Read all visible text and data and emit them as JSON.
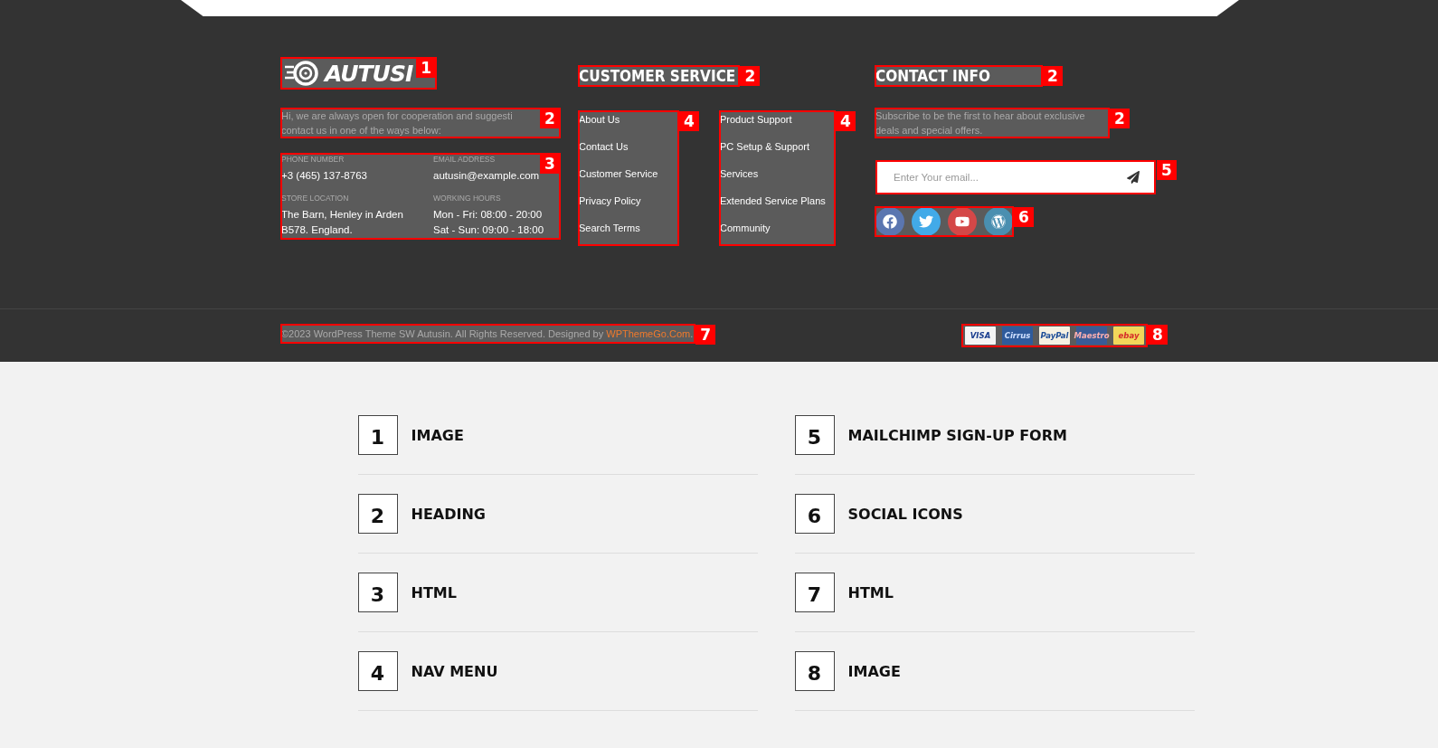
{
  "footer": {
    "brand": {
      "logo_text": "AUTUSI",
      "annotation": "1"
    },
    "intro": {
      "lines": [
        "Hi, we are always open for cooperation and suggesti",
        "contact us in one of the ways below:"
      ],
      "annotation": "2"
    },
    "contacts": {
      "annotation": "3",
      "items": [
        {
          "label": "PHONE NUMBER",
          "lines": [
            "+3 (465) 137-8763"
          ]
        },
        {
          "label": "EMAIL ADDRESS",
          "lines": [
            "autusin@example.com"
          ]
        },
        {
          "label": "STORE LOCATION",
          "lines": [
            "The Barn, Henley in Arden",
            "B578. England."
          ]
        },
        {
          "label": "WORKING HOURS",
          "lines": [
            "Mon - Fri: 08:00 - 20:00",
            "Sat - Sun: 09:00 - 18:00"
          ]
        }
      ]
    },
    "customer_service": {
      "heading": "CUSTOMER SERVICE",
      "heading_annotation": "2",
      "menus": [
        {
          "annotation": "4",
          "links": [
            "About Us",
            "Contact Us",
            "Customer Service",
            "Privacy Policy",
            "Search Terms"
          ]
        },
        {
          "annotation": "4",
          "links": [
            "Product Support",
            "PC Setup & Support",
            "Services",
            "Extended Service Plans",
            "Community"
          ]
        }
      ]
    },
    "contact_info": {
      "heading": "CONTACT INFO",
      "heading_annotation": "2",
      "text": {
        "lines": [
          "Subscribe to be the first to hear about exclusive",
          "deals and special offers."
        ],
        "annotation": "2"
      },
      "signup": {
        "placeholder": "Enter Your email...",
        "annotation": "5"
      },
      "social": {
        "annotation": "6",
        "icons": [
          {
            "kind": "facebook",
            "color": "#5b76b0"
          },
          {
            "kind": "twitter",
            "color": "#42aae8"
          },
          {
            "kind": "youtube",
            "color": "#d44848"
          },
          {
            "kind": "wordpress",
            "color": "#4a8fb0"
          }
        ]
      }
    },
    "bottom": {
      "copyright": "©2023 WordPress Theme SW Autusin. All Rights Reserved. Designed by ",
      "link": "WPThemeGo.Com",
      "after": ".",
      "annotation": "7",
      "payments": {
        "annotation": "8",
        "cards": [
          {
            "kind": "visa",
            "label": "VISA"
          },
          {
            "kind": "cirrus",
            "label": "Cirrus"
          },
          {
            "kind": "paypal",
            "label": "PayPal"
          },
          {
            "kind": "maestro",
            "label": "Maestro"
          },
          {
            "kind": "ebay",
            "label": "ebay"
          }
        ]
      }
    }
  },
  "legend": {
    "columns": [
      [
        {
          "number": "1",
          "label": "IMAGE"
        },
        {
          "number": "2",
          "label": "HEADING"
        },
        {
          "number": "3",
          "label": "HTML"
        },
        {
          "number": "4",
          "label": "NAV MENU"
        }
      ],
      [
        {
          "number": "5",
          "label": "MAILCHIMP SIGN-UP FORM"
        },
        {
          "number": "6",
          "label": "SOCIAL ICONS"
        },
        {
          "number": "7",
          "label": "HTML"
        },
        {
          "number": "8",
          "label": "IMAGE"
        }
      ]
    ]
  }
}
